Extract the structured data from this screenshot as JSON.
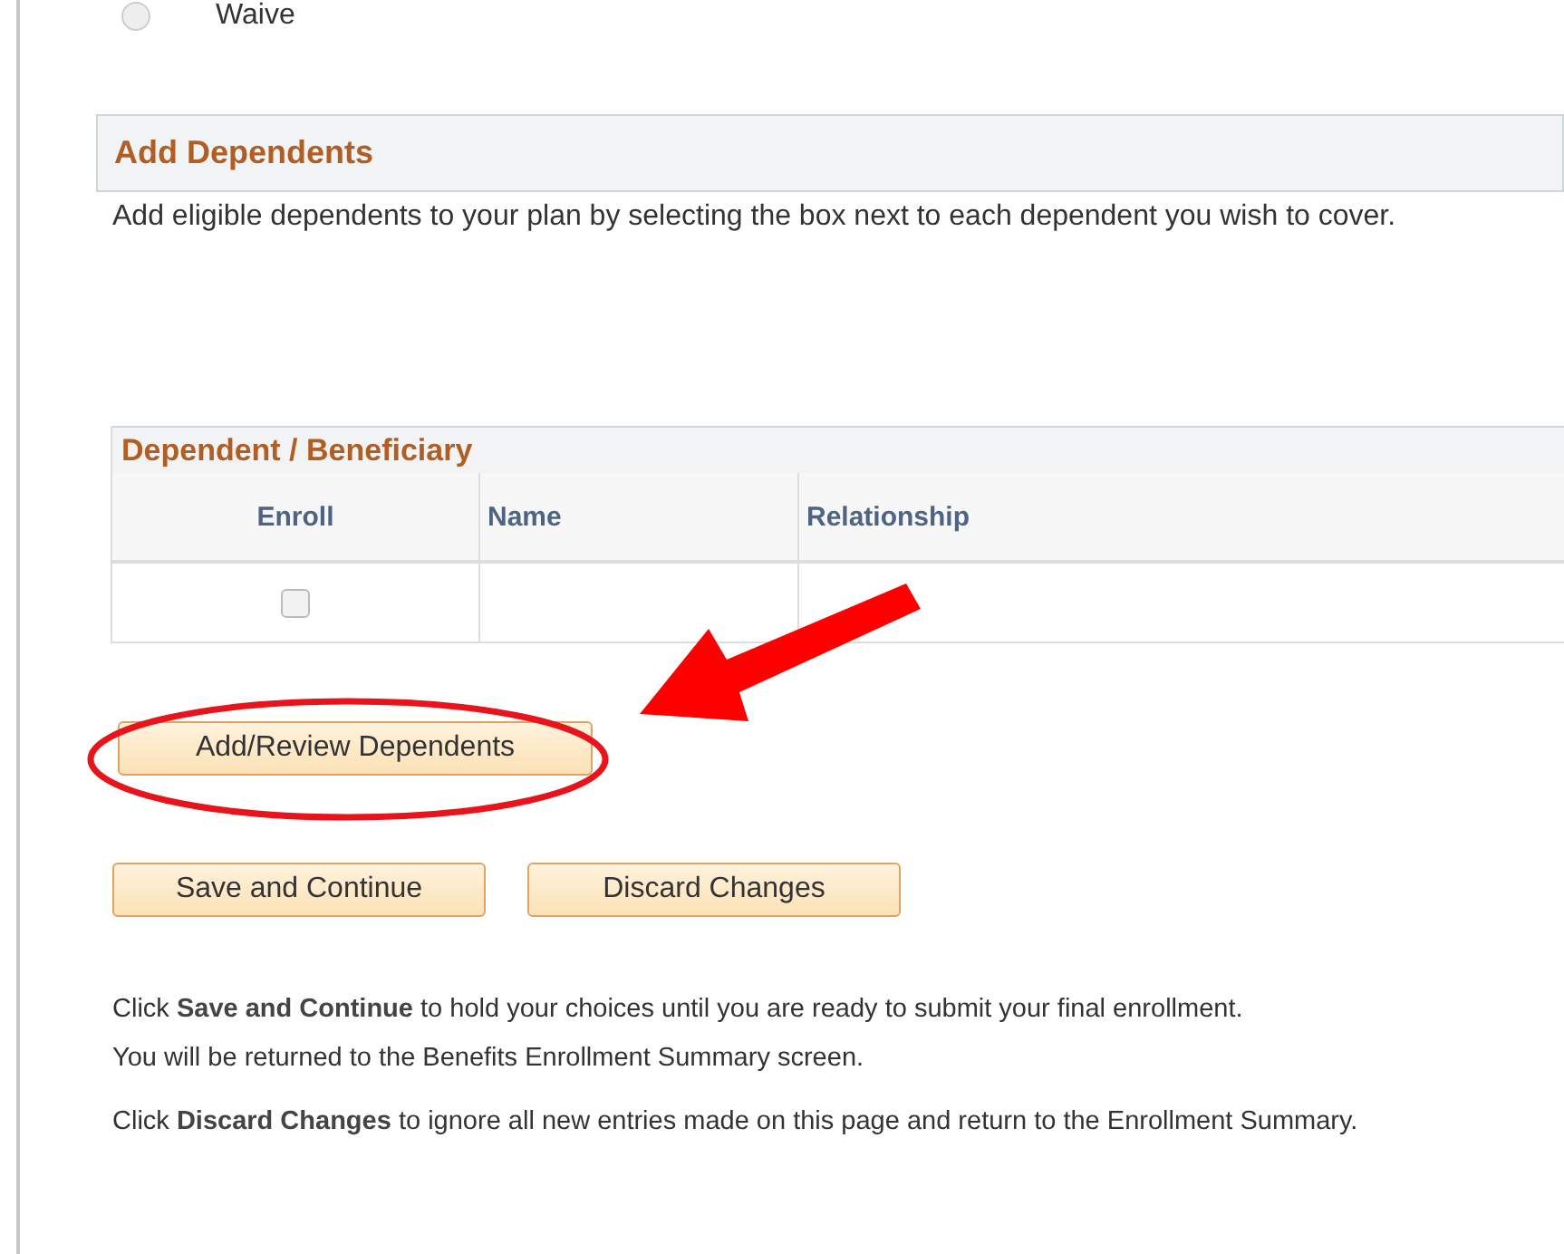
{
  "option": {
    "label": "Waive",
    "selected": false
  },
  "section": {
    "title": "Add Dependents",
    "description": "Add eligible dependents to your plan by selecting the box next to each dependent you wish to cover."
  },
  "table": {
    "title": "Dependent / Beneficiary",
    "columns": [
      "Enroll",
      "Name",
      "Relationship"
    ],
    "rows": [
      {
        "enroll": false
      }
    ]
  },
  "add_button": "Add/Review Dependents",
  "buttons": [
    "Save and Continue",
    "Discard Changes"
  ],
  "notes": [
    "Click **Save and Continue** to hold your choices until you are ready to submit your final enrollment.\nYou will be returned to the Benefits Enrollment Summary screen.",
    "Click **Discard Changes** to ignore all new entries made on this page and return to the Enrollment Summary."
  ]
}
